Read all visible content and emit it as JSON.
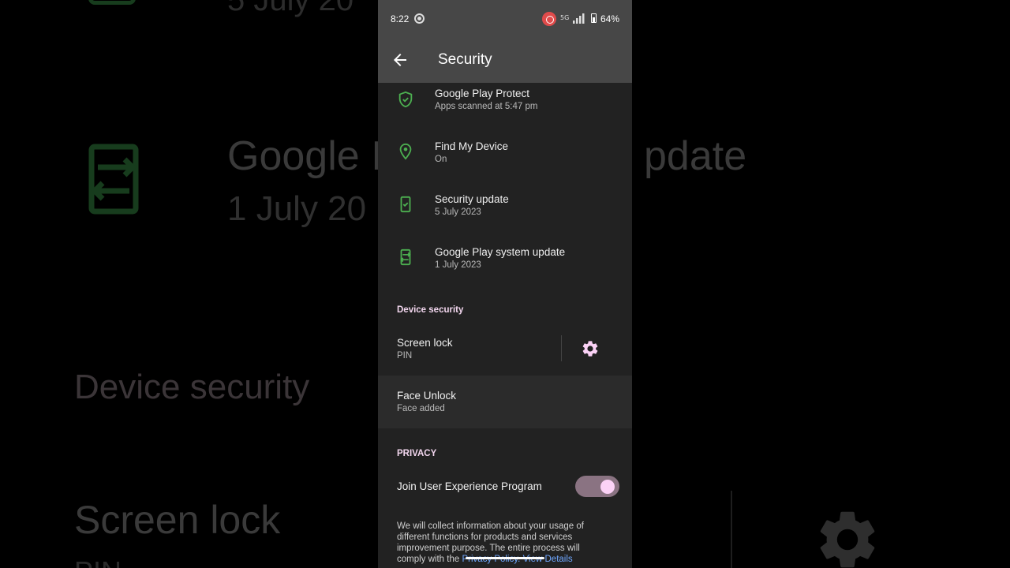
{
  "background": {
    "top_sub": "5 July 20",
    "title1": "Google I",
    "title1_right": "pdate",
    "sub1": "1 July 20",
    "title2": "Device security",
    "title3": "Screen lock",
    "sub3": "PIN"
  },
  "status_bar": {
    "time": "8:22",
    "network": "5G",
    "battery": "64%"
  },
  "app_bar": {
    "title": "Security"
  },
  "status_items": [
    {
      "title": "Google Play Protect",
      "subtitle": "Apps scanned at 5:47 pm",
      "icon": "shield-check-icon"
    },
    {
      "title": "Find My Device",
      "subtitle": "On",
      "icon": "location-pin-icon"
    },
    {
      "title": "Security update",
      "subtitle": "5 July 2023",
      "icon": "phone-check-icon"
    },
    {
      "title": "Google Play system update",
      "subtitle": "1 July 2023",
      "icon": "phone-sync-icon"
    }
  ],
  "device_security": {
    "header": "Device security",
    "screen_lock": {
      "title": "Screen lock",
      "subtitle": "PIN"
    },
    "face_unlock": {
      "title": "Face Unlock",
      "subtitle": "Face added"
    }
  },
  "privacy": {
    "header": "PRIVACY",
    "join_program": {
      "label": "Join User Experience Program",
      "enabled": true
    },
    "notice_text": "We will collect information about your usage of different functions for products and services improvement purpose. The entire process will comply with the",
    "policy_link": "Privacy Policy.",
    "details_link": "View Details"
  },
  "colors": {
    "accent_green": "#4caf50",
    "accent_pink": "#f2d6ee",
    "link_blue": "#6fa7ff",
    "appbar": "#474747",
    "surface": "#222222"
  }
}
